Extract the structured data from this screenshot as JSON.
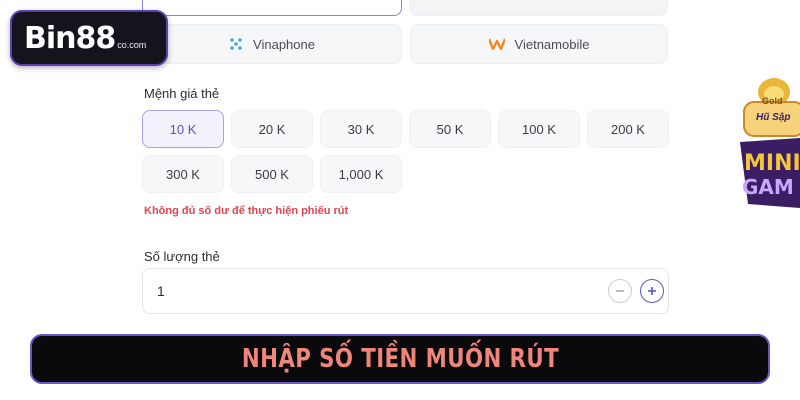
{
  "logo": {
    "main": "Bin88",
    "sub": "co.com"
  },
  "carriers": [
    {
      "label": "Vinaphone",
      "icon": "vinaphone-icon",
      "color": "#4aa3e0"
    },
    {
      "label": "Vietnamobile",
      "icon": "vietnamobile-icon",
      "color": "#f08a1c"
    }
  ],
  "denomination": {
    "label": "Mệnh giá thẻ",
    "options": [
      "10 K",
      "20 K",
      "30 K",
      "50 K",
      "100 K",
      "200 K",
      "300 K",
      "500 K",
      "1,000 K"
    ],
    "selected": "10 K"
  },
  "error": "Không đủ số dư để thực hiện phiếu rút",
  "quantity": {
    "label": "Số lượng thẻ",
    "value": "1"
  },
  "minigame": {
    "line1": "Gold",
    "line2": "Hũ Sập"
  },
  "banner": "NHẬP SỐ TIỀN MUỐN RÚT",
  "colors": {
    "accent": "#5b55c9",
    "error": "#e0454f",
    "banner_text": "#f0857a"
  }
}
